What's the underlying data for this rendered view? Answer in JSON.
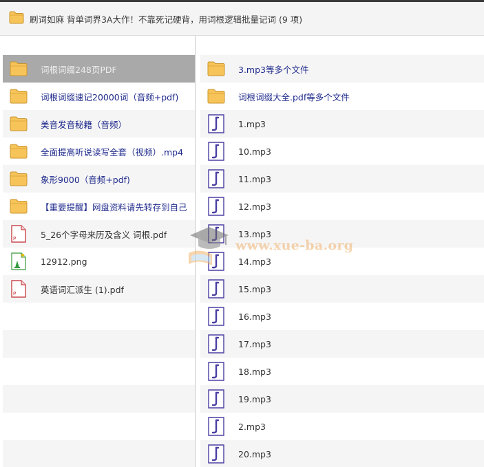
{
  "window": {
    "title": "刷词如麻 背单词界3A大作！不靠死记硬背，用词根逻辑批量记词 (9 项)"
  },
  "left_items": [
    {
      "label": "词根词缀248页PDF",
      "icon": "folder-icon",
      "kind": "folder",
      "selected": true
    },
    {
      "label": "词根词缀速记20000词（音频+pdf)",
      "icon": "folder-icon",
      "kind": "folder"
    },
    {
      "label": "美音发音秘籍（音频）",
      "icon": "folder-icon",
      "kind": "folder"
    },
    {
      "label": "全面提高听说读写全套（视频）.mp4",
      "icon": "folder-icon",
      "kind": "folder"
    },
    {
      "label": "象形9000（音频+pdf)",
      "icon": "folder-icon",
      "kind": "folder"
    },
    {
      "label": "【重要提醒】网盘资料请先转存到自己",
      "icon": "folder-icon",
      "kind": "folder"
    },
    {
      "label": "5_26个字母来历及含义 词根.pdf",
      "icon": "pdf-file-icon",
      "kind": "pdf"
    },
    {
      "label": "12912.png",
      "icon": "image-file-icon",
      "kind": "png"
    },
    {
      "label": "英语词汇派生 (1).pdf",
      "icon": "pdf-file-icon",
      "kind": "pdf"
    }
  ],
  "right_items": [
    {
      "label": "3.mp3等多个文件",
      "icon": "folder-icon",
      "kind": "folder"
    },
    {
      "label": "词根词缀大全.pdf等多个文件",
      "icon": "folder-icon",
      "kind": "folder"
    },
    {
      "label": "1.mp3",
      "icon": "audio-file-icon",
      "kind": "mp3"
    },
    {
      "label": "10.mp3",
      "icon": "audio-file-icon",
      "kind": "mp3"
    },
    {
      "label": "11.mp3",
      "icon": "audio-file-icon",
      "kind": "mp3"
    },
    {
      "label": "12.mp3",
      "icon": "audio-file-icon",
      "kind": "mp3"
    },
    {
      "label": "13.mp3",
      "icon": "audio-file-icon",
      "kind": "mp3"
    },
    {
      "label": "14.mp3",
      "icon": "audio-file-icon",
      "kind": "mp3"
    },
    {
      "label": "15.mp3",
      "icon": "audio-file-icon",
      "kind": "mp3"
    },
    {
      "label": "16.mp3",
      "icon": "audio-file-icon",
      "kind": "mp3"
    },
    {
      "label": "17.mp3",
      "icon": "audio-file-icon",
      "kind": "mp3"
    },
    {
      "label": "18.mp3",
      "icon": "audio-file-icon",
      "kind": "mp3"
    },
    {
      "label": "19.mp3",
      "icon": "audio-file-icon",
      "kind": "mp3"
    },
    {
      "label": "2.mp3",
      "icon": "audio-file-icon",
      "kind": "mp3"
    },
    {
      "label": "20.mp3",
      "icon": "audio-file-icon",
      "kind": "mp3"
    }
  ],
  "watermark": {
    "text": "www.xue-ba.org"
  },
  "colors": {
    "link_text": "#1f2a8c",
    "selected_row": "#a9a9a9",
    "folder": "#f7c45a"
  }
}
